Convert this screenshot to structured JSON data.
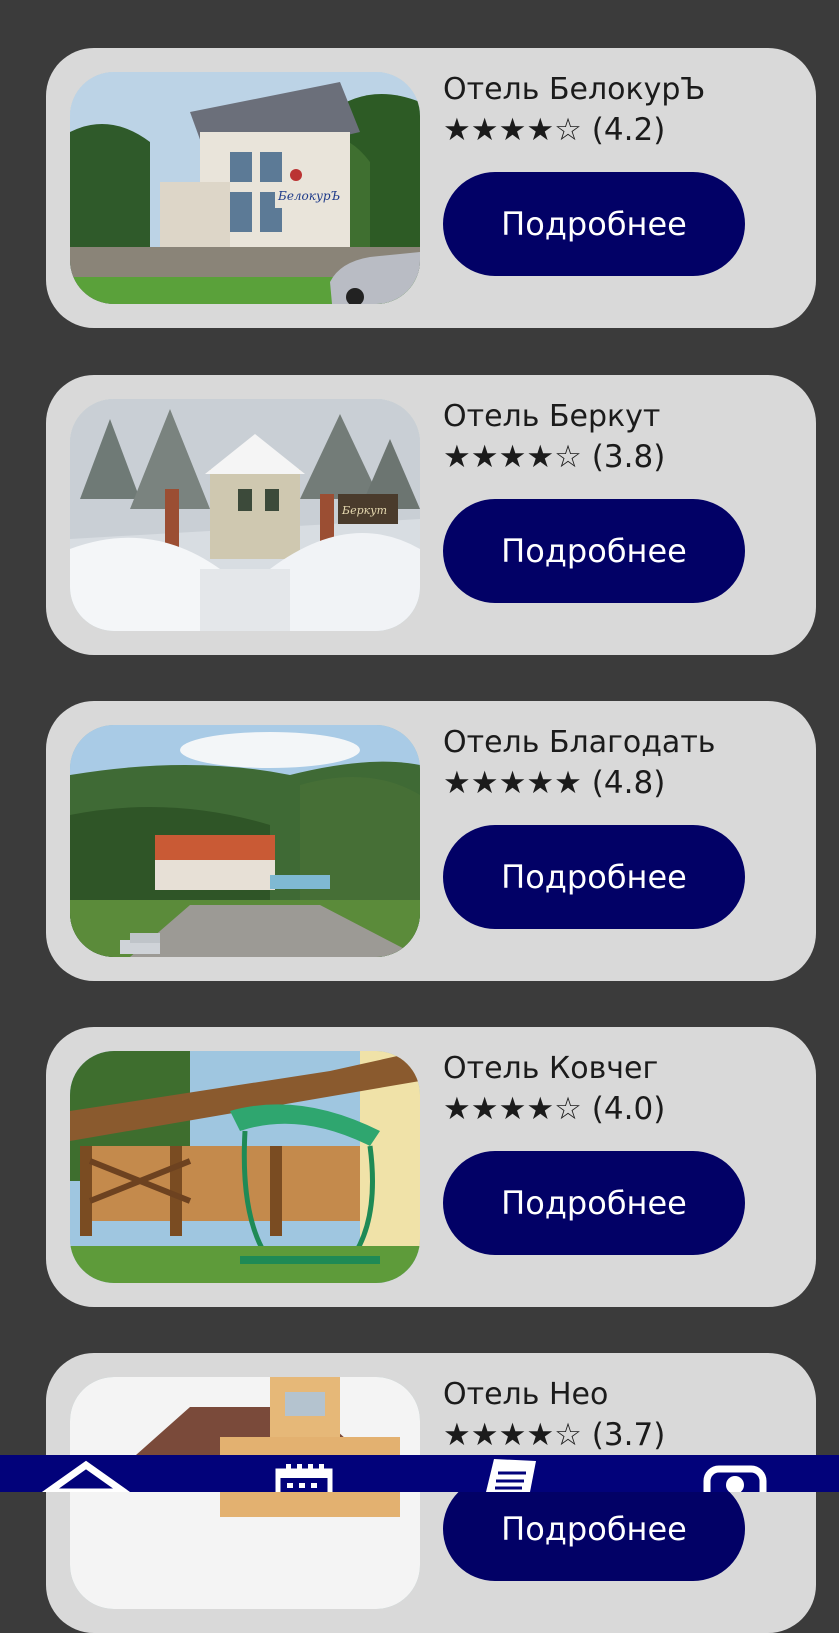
{
  "hotels": [
    {
      "name": "Отель БелокурЪ",
      "rating_stars": "★★★★☆ (4.2)",
      "rating": 4.2,
      "button_label": "Подробнее",
      "sign_text": "БелокурЪ"
    },
    {
      "name": "Отель Беркут",
      "rating_stars": "★★★★☆ (3.8)",
      "rating": 3.8,
      "button_label": "Подробнее",
      "sign_text": "Беркут"
    },
    {
      "name": "Отель Благодать",
      "rating_stars": "★★★★★ (4.8)",
      "rating": 4.8,
      "button_label": "Подробнее"
    },
    {
      "name": "Отель Ковчег",
      "rating_stars": "★★★★☆ (4.0)",
      "rating": 4.0,
      "button_label": "Подробнее"
    },
    {
      "name": "Отель Нео",
      "rating_stars": "★★★★☆ (3.7)",
      "rating": 3.7,
      "button_label": "Подробнее"
    }
  ],
  "bottom_nav": {
    "items": [
      {
        "icon": "home-icon"
      },
      {
        "icon": "calendar-icon"
      },
      {
        "icon": "document-icon"
      },
      {
        "icon": "profile-icon"
      }
    ]
  },
  "colors": {
    "background": "#3b3b3b",
    "card": "#d9d9d9",
    "button": "#020166",
    "nav_bar": "#02027a"
  }
}
